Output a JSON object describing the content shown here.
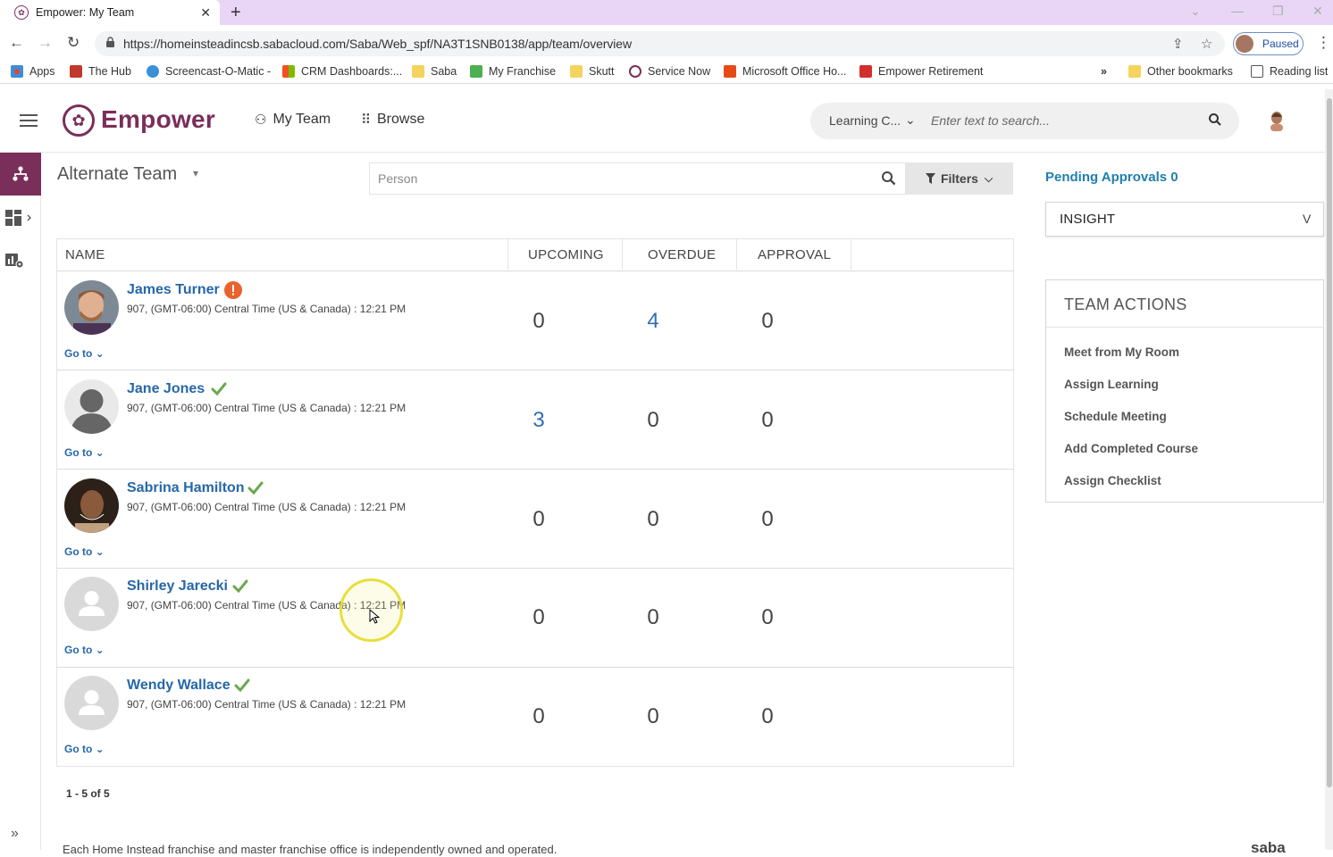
{
  "browser": {
    "tab_title": "Empower: My Team",
    "url": "https://homeinsteadincsb.sabacloud.com/Saba/Web_spf/NA3T1SNB0138/app/team/overview",
    "profile_label": "Paused",
    "bookmarks": [
      {
        "label": "Apps",
        "color": "#e0483a"
      },
      {
        "label": "The Hub",
        "color": "#c0392b"
      },
      {
        "label": "Screencast-O-Matic -",
        "color": "#3a8fd8"
      },
      {
        "label": "CRM Dashboards:...",
        "color": "#f2b01e"
      },
      {
        "label": "Saba",
        "color": "#f4d35e"
      },
      {
        "label": "My Franchise",
        "color": "#4caf50"
      },
      {
        "label": "Skutt",
        "color": "#f4d35e"
      },
      {
        "label": "Service Now",
        "color": "#7a2e5a"
      },
      {
        "label": "Microsoft Office Ho...",
        "color": "#e64a19"
      },
      {
        "label": "Empower Retirement",
        "color": "#d32f2f"
      }
    ],
    "overflow": "»",
    "other_bookmarks": "Other bookmarks",
    "reading_list": "Reading list"
  },
  "header": {
    "logo": "Empower",
    "nav_my_team": "My Team",
    "nav_browse": "Browse",
    "search_scope": "Learning C...",
    "search_placeholder": "Enter text to search..."
  },
  "team": {
    "title": "Alternate Team",
    "person_placeholder": "Person",
    "filters_label": "Filters"
  },
  "table": {
    "columns": [
      "NAME",
      "UPCOMING",
      "OVERDUE",
      "APPROVAL"
    ],
    "rows": [
      {
        "name": "James Turner",
        "meta": "907, (GMT-06:00) Central Time (US & Canada) : 12:21 PM",
        "status": "alert",
        "upcoming": "0",
        "overdue": "4",
        "approval": "0",
        "goto": "Go to",
        "avatar": "photo-man"
      },
      {
        "name": "Jane Jones",
        "meta": "907, (GMT-06:00) Central Time (US & Canada) : 12:21 PM",
        "status": "check",
        "upcoming": "3",
        "overdue": "0",
        "approval": "0",
        "goto": "Go to",
        "avatar": "silhouette-dark"
      },
      {
        "name": "Sabrina Hamilton",
        "meta": "907, (GMT-06:00) Central Time (US & Canada) : 12:21 PM",
        "status": "check",
        "upcoming": "0",
        "overdue": "0",
        "approval": "0",
        "goto": "Go to",
        "avatar": "photo-woman"
      },
      {
        "name": "Shirley Jarecki",
        "meta": "907, (GMT-06:00) Central Time (US & Canada) : 12:21 PM",
        "status": "check",
        "upcoming": "0",
        "overdue": "0",
        "approval": "0",
        "goto": "Go to",
        "avatar": "placeholder"
      },
      {
        "name": "Wendy Wallace",
        "meta": "907, (GMT-06:00) Central Time (US & Canada) : 12:21 PM",
        "status": "check",
        "upcoming": "0",
        "overdue": "0",
        "approval": "0",
        "goto": "Go to",
        "avatar": "placeholder"
      }
    ],
    "pager": "1 - 5 of 5"
  },
  "side": {
    "pending_approvals": "Pending Approvals 0",
    "insight_label": "INSIGHT",
    "insight_toggle": "V",
    "team_actions_title": "TEAM ACTIONS",
    "actions": [
      "Meet from My Room",
      "Assign Learning",
      "Schedule Meeting",
      "Add Completed Course",
      "Assign Checklist"
    ]
  },
  "footer": {
    "text": "Each Home Instead franchise and master franchise office is independently owned and operated.",
    "brand": "saba"
  },
  "colors": {
    "brand": "#7a2e5a",
    "link": "#2667a8",
    "alert": "#e8622c",
    "check": "#6aa84f"
  }
}
